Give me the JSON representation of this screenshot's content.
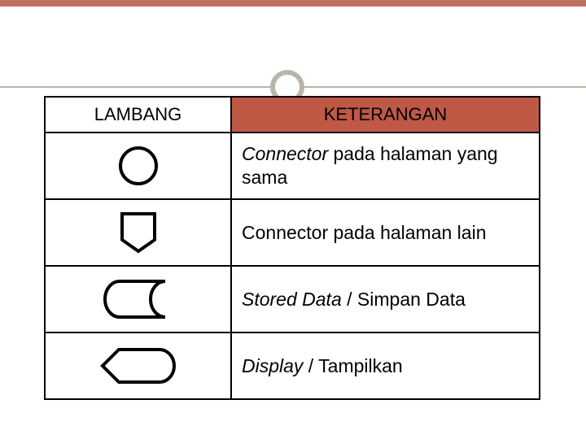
{
  "header": {
    "col1": "LAMBANG",
    "col2": "KETERANGAN"
  },
  "rows": [
    {
      "symbol": "connector-same-page-icon",
      "desc_italic": "Connector",
      "desc_plain": " pada halaman yang sama"
    },
    {
      "symbol": "connector-off-page-icon",
      "desc_italic": "",
      "desc_plain": "Connector pada halaman lain"
    },
    {
      "symbol": "stored-data-icon",
      "desc_italic": "Stored Data",
      "desc_plain": " / Simpan Data"
    },
    {
      "symbol": "display-icon",
      "desc_italic": "Display",
      "desc_plain": " / Tampilkan"
    }
  ]
}
